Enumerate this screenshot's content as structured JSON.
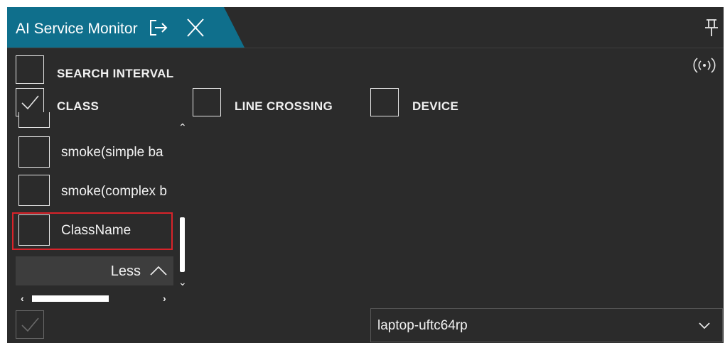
{
  "window": {
    "tab_title": "AI Service Monitor",
    "icons": {
      "export": "export-icon",
      "close": "close-icon",
      "pin": "pin-icon",
      "broadcast": "broadcast-icon"
    }
  },
  "filters": {
    "search_interval": {
      "label": "SEARCH INTERVAL",
      "checked": false
    },
    "class": {
      "label": "CLASS",
      "checked": true
    },
    "line_crossing": {
      "label": "LINE CROSSING",
      "checked": false
    },
    "device": {
      "label": "DEVICE",
      "checked": false
    }
  },
  "class_list": {
    "items": [
      {
        "label": "smoke(simple ba",
        "checked": false
      },
      {
        "label": "smoke(complex b",
        "checked": false
      },
      {
        "label": "ClassName",
        "checked": false,
        "highlighted": true
      }
    ],
    "less_label": "Less"
  },
  "footer": {
    "checkbox_checked": true,
    "checkbox_disabled": true,
    "device_select": {
      "value": "laptop-uftc64rp"
    }
  },
  "colors": {
    "accent": "#0f6f8c",
    "background": "#2b2b2b",
    "highlight": "#d9232a"
  }
}
